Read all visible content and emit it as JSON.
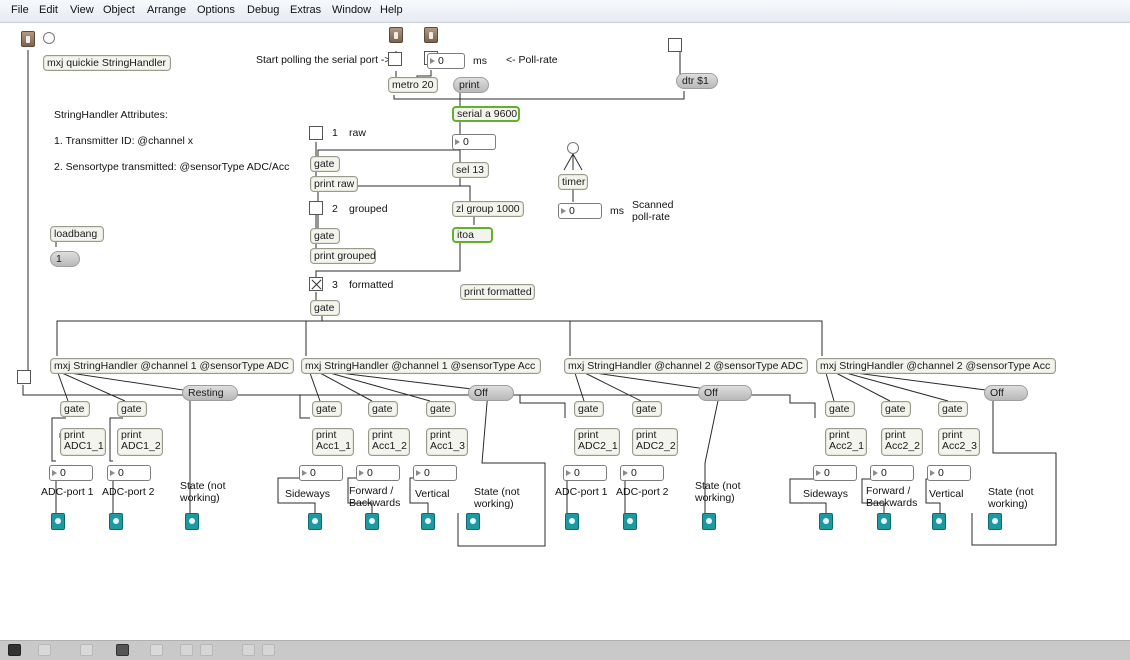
{
  "menu": [
    "File",
    "Edit",
    "View",
    "Object",
    "Arrange",
    "Options",
    "Debug",
    "Extras",
    "Window",
    "Help"
  ],
  "top": {
    "quickie": "mxj quickie StringHandler",
    "start_polling": "Start polling the serial port ->",
    "poll_value": "0",
    "ms_label": "ms",
    "poll_rate_label": "<- Poll-rate",
    "metro": "metro 20",
    "print": "print",
    "dtr": "dtr $1",
    "serial": "serial a 9600",
    "serial_num": "0",
    "sel": "sel 13",
    "zl_group": "zl group 1000",
    "itoa": "itoa",
    "print_formatted": "print formatted",
    "timer": "timer",
    "timer_num": "0",
    "timer_ms": "ms",
    "scanned_poll_rate": "Scanned poll-rate",
    "loadbang": "loadbang",
    "one_msg": "1"
  },
  "attributes": {
    "title": "StringHandler Attributes:",
    "line1": "1. Transmitter ID: @channel x",
    "line2": "2. Sensortype transmitted: @sensorType ADC/Acc"
  },
  "gates": {
    "raw_num": "1",
    "raw_label": "raw",
    "gate": "gate",
    "print_raw": "print raw",
    "grouped_num": "2",
    "grouped_label": "grouped",
    "print_grouped": "print grouped",
    "formatted_num": "3",
    "formatted_label": "formatted"
  },
  "handlers": {
    "h1": "mxj StringHandler @channel 1 @sensorType ADC",
    "h2": "mxj StringHandler @channel 1 @sensorType Acc",
    "h3": "mxj StringHandler @channel 2 @sensorType ADC",
    "h4": "mxj StringHandler @channel 2 @sensorType Acc"
  },
  "states": {
    "s1": "Resting",
    "s2": "Off",
    "s3": "Off",
    "s4": "Off"
  },
  "prints": {
    "p1": "print ADC1_1",
    "p2": "print ADC1_2",
    "p3": "print Acc1_1",
    "p4": "print Acc1_2",
    "p5": "print Acc1_3",
    "p6": "print ADC2_1",
    "p7": "print ADC2_2",
    "p8": "print Acc2_1",
    "p9": "print Acc2_2",
    "p10": "print Acc2_3"
  },
  "numbers": {
    "value": "0"
  },
  "labels": {
    "adc1": "ADC-port 1",
    "adc2": "ADC-port 2",
    "state": "State (not working)",
    "sideways": "Sideways",
    "fwd": "Forward / Backwards",
    "vertical": "Vertical"
  },
  "icons": {
    "lock": "lock-icon",
    "add": "add-icon",
    "move": "move-icon",
    "present": "presentation-icon",
    "info": "info-icon",
    "col1": "color-icon",
    "col2": "color-icon-2",
    "grid": "grid-icon",
    "snap": "snap-icon"
  },
  "colors": {
    "accent_green": "#62b02e",
    "output_teal": "#1d9aa1",
    "brown_button": "#8f7a64"
  }
}
